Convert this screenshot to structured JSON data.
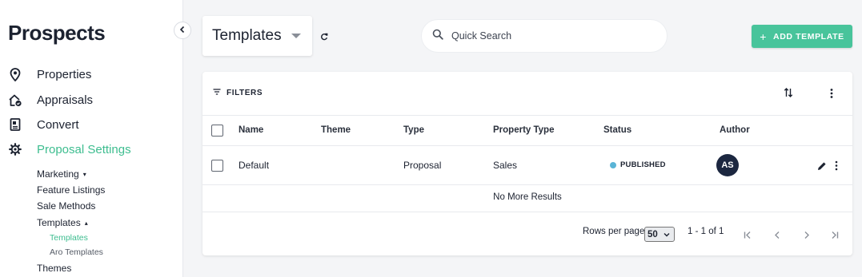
{
  "sidebar": {
    "brand": "Prospects",
    "nav": [
      {
        "label": "Properties",
        "icon": "map-pin-icon"
      },
      {
        "label": "Appraisals",
        "icon": "home-check-icon"
      },
      {
        "label": "Convert",
        "icon": "document-icon"
      },
      {
        "label": "Proposal Settings",
        "icon": "gear-icon",
        "active": true
      }
    ],
    "sub": [
      {
        "label": "Marketing",
        "caret": "▾"
      },
      {
        "label": "Feature Listings"
      },
      {
        "label": "Sale Methods"
      },
      {
        "label": "Templates",
        "caret": "▴"
      },
      {
        "label": "Themes"
      }
    ],
    "subsub": [
      {
        "label": "Templates",
        "active": true
      },
      {
        "label": "Aro Templates"
      }
    ]
  },
  "header": {
    "template_select": "Templates",
    "search_placeholder": "Quick Search",
    "add_button": "ADD TEMPLATE"
  },
  "table": {
    "filters_label": "FILTERS",
    "columns": [
      "Name",
      "Theme",
      "Type",
      "Property Type",
      "Status",
      "Author"
    ],
    "rows": [
      {
        "name": "Default",
        "theme": "",
        "type": "Proposal",
        "property_type": "Sales",
        "status": "PUBLISHED",
        "author_initials": "AS"
      }
    ],
    "no_more": "No More Results",
    "rows_per_page_label": "Rows per page",
    "rows_per_page_value": "50",
    "range": "1 - 1 of 1"
  },
  "colors": {
    "accent": "#3dbd8f",
    "button": "#48c49b",
    "status_dot": "#5ab4d6",
    "avatar": "#1c2740"
  }
}
